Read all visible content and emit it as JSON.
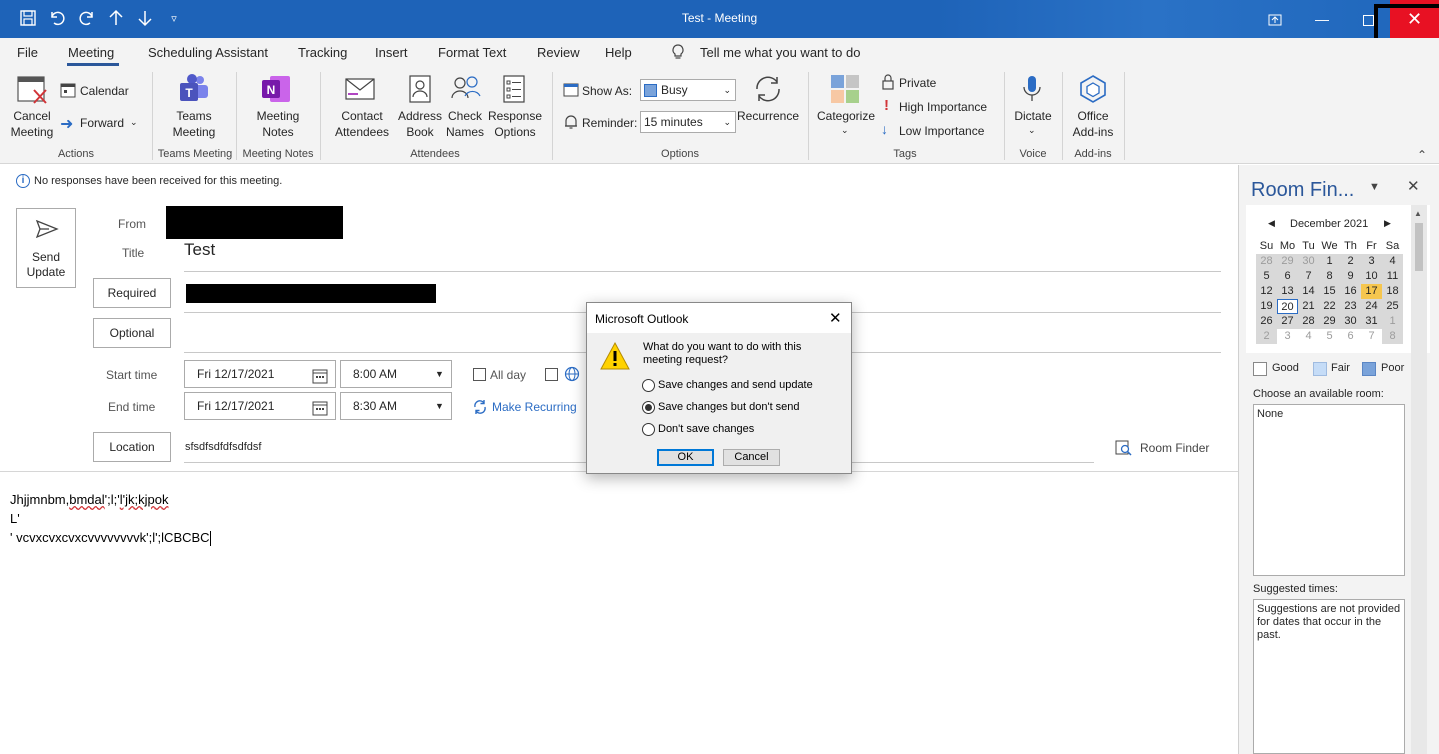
{
  "window": {
    "title": "Test  -  Meeting"
  },
  "quick_access": {
    "icons": [
      "save-icon",
      "undo-icon",
      "redo-icon",
      "up-arrow-icon",
      "down-arrow-icon",
      "customize-icon"
    ]
  },
  "menu": {
    "file": "File",
    "meeting": "Meeting",
    "scheduling": "Scheduling Assistant",
    "tracking": "Tracking",
    "insert": "Insert",
    "format_text": "Format Text",
    "review": "Review",
    "help": "Help",
    "tell_me": "Tell me what you want to do"
  },
  "ribbon": {
    "cancel_meeting_1": "Cancel",
    "cancel_meeting_2": "Meeting",
    "calendar": "Calendar",
    "forward": "Forward",
    "actions": "Actions",
    "teams_meeting_1": "Teams",
    "teams_meeting_2": "Meeting",
    "teams_meeting_group": "Teams Meeting",
    "meeting_notes_1": "Meeting",
    "meeting_notes_2": "Notes",
    "meeting_notes_group": "Meeting Notes",
    "contact_attendees_1": "Contact",
    "contact_attendees_2": "Attendees",
    "address_book_1": "Address",
    "address_book_2": "Book",
    "check_names_1": "Check",
    "check_names_2": "Names",
    "response_options_1": "Response",
    "response_options_2": "Options",
    "attendees_group": "Attendees",
    "show_as_label": "Show As:",
    "show_as_value": "Busy",
    "reminder_label": "Reminder:",
    "reminder_value": "15 minutes",
    "recurrence": "Recurrence",
    "options_group": "Options",
    "categorize": "Categorize",
    "private": "Private",
    "high_importance": "High Importance",
    "low_importance": "Low Importance",
    "tags_group": "Tags",
    "dictate": "Dictate",
    "voice_group": "Voice",
    "office_addins_1": "Office",
    "office_addins_2": "Add-ins",
    "addins_group": "Add-ins"
  },
  "info_bar": {
    "text": "No responses have been received for this meeting."
  },
  "form": {
    "send_update_1": "Send",
    "send_update_2": "Update",
    "from_label": "From",
    "title_label": "Title",
    "title_value": "Test",
    "required_button": "Required",
    "optional_button": "Optional",
    "start_time_label": "Start time",
    "start_date": "Fri 12/17/2021",
    "start_time": "8:00 AM",
    "all_day": "All day",
    "end_time_label": "End time",
    "end_date": "Fri 12/17/2021",
    "end_time": "8:30 AM",
    "make_recurring": "Make Recurring",
    "location_button": "Location",
    "location_value": "sfsdfsdfdfsdfdsf",
    "room_finder": "Room Finder"
  },
  "body": {
    "line1_a": "Jhjjmnbm,",
    "line1_b": "bmdal",
    "line1_c": "';l;'",
    "line1_d": "l'jk;kjpok",
    "line2": "L'",
    "line3": "' vcvxcvxcvxcvvvvvvvvk';l';lCBCBC"
  },
  "side_pane": {
    "title": "Room Fin...",
    "month": "December 2021",
    "weekdays": [
      "Su",
      "Mo",
      "Tu",
      "We",
      "Th",
      "Fr",
      "Sa"
    ],
    "weeks": [
      [
        "28",
        "29",
        "30",
        "1",
        "2",
        "3",
        "4"
      ],
      [
        "5",
        "6",
        "7",
        "8",
        "9",
        "10",
        "11"
      ],
      [
        "12",
        "13",
        "14",
        "15",
        "16",
        "17",
        "18"
      ],
      [
        "19",
        "20",
        "21",
        "22",
        "23",
        "24",
        "25"
      ],
      [
        "26",
        "27",
        "28",
        "29",
        "30",
        "31",
        "1"
      ],
      [
        "2",
        "3",
        "4",
        "5",
        "6",
        "7",
        "8"
      ]
    ],
    "selected_day": "17",
    "today": "20",
    "legend_good": "Good",
    "legend_fair": "Fair",
    "legend_poor": "Poor",
    "choose_room_label": "Choose an available room:",
    "room_value": "None",
    "suggested_label": "Suggested times:",
    "suggested_text": "Suggestions are not provided for dates that occur in the past.",
    "colors": {
      "fair": "#c5dcf7",
      "poor": "#7aa3da"
    }
  },
  "dialog": {
    "title": "Microsoft Outlook",
    "question": "What do you want to do with this meeting request?",
    "option1": "Save changes and send update",
    "option2": "Save changes but don't send",
    "option3": "Don't save changes",
    "selected_option": 2,
    "ok": "OK",
    "cancel": "Cancel"
  }
}
